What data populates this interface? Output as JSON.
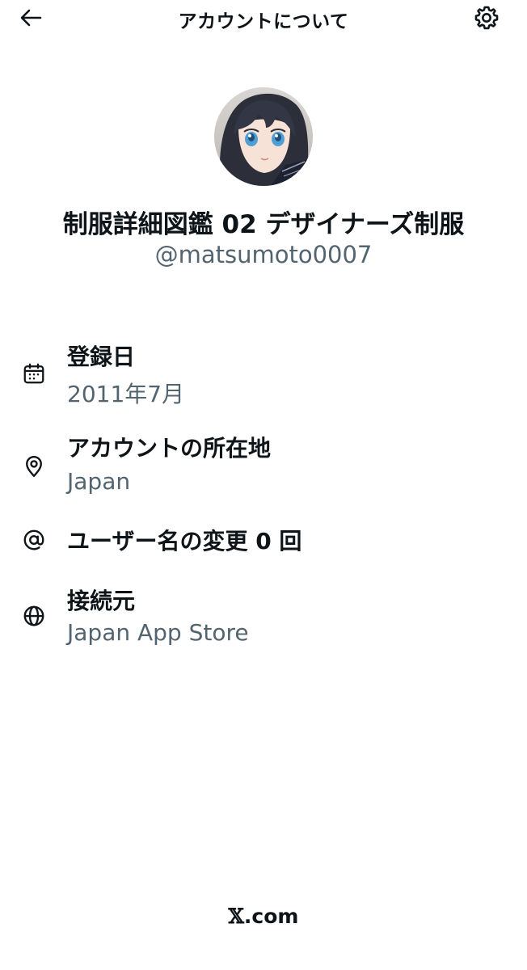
{
  "header": {
    "title": "アカウントについて"
  },
  "profile": {
    "display_name": "制服詳細図鑑 02 デザイナーズ制服",
    "handle": "@matsumoto0007"
  },
  "info": {
    "joined": {
      "label": "登録日",
      "value": "2011年7月",
      "icon": "calendar-icon"
    },
    "location": {
      "label": "アカウントの所在地",
      "value": "Japan",
      "icon": "location-pin-icon"
    },
    "username_changes": {
      "label": "ユーザー名の変更 0 回",
      "icon": "at-sign-icon"
    },
    "connected_via": {
      "label": "接続元",
      "value": "Japan App Store",
      "icon": "globe-icon"
    }
  },
  "footer": {
    "brand_mark": "𝕏",
    "brand_suffix": ".com"
  },
  "colors": {
    "text_primary": "#0f1419",
    "text_secondary": "#536471",
    "background": "#ffffff"
  }
}
